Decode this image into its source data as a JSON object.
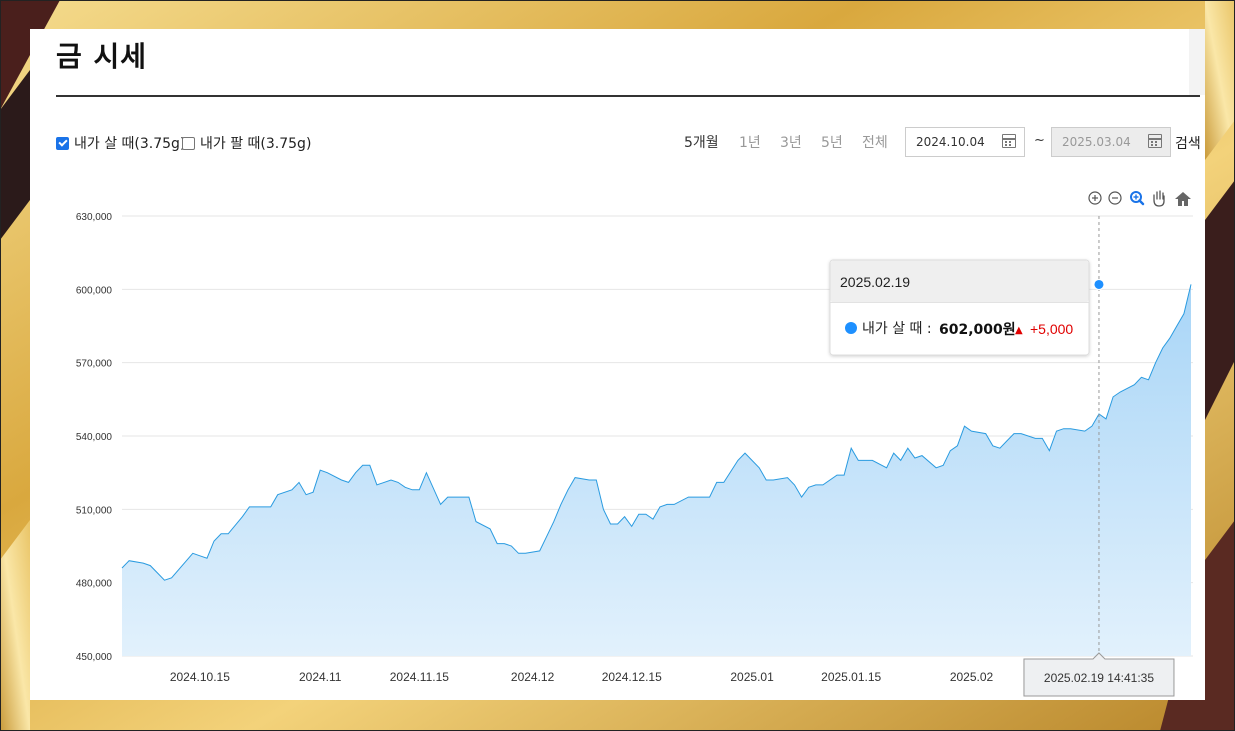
{
  "header": {
    "title": "금 시세"
  },
  "filters": {
    "buy_label": "내가 살 때(3.75g)",
    "sell_label": "내가 팔 때(3.75g)",
    "buy_checked": true,
    "sell_checked": false
  },
  "periods": [
    "5개월",
    "1년",
    "3년",
    "5년",
    "전체"
  ],
  "active_period": "5개월",
  "date_range": {
    "start": "2024.10.04",
    "end": "2025.03.04",
    "separator": "~"
  },
  "search_label": "검색",
  "toolbar_icons": [
    "zoom-in-icon",
    "zoom-out-icon",
    "magnify-icon",
    "pan-hand-icon",
    "home-icon"
  ],
  "colors": {
    "line": "#2a9be0",
    "fill_top": "#a8d5f7",
    "fill_bottom": "#e2f1fc",
    "accent": "#1a73e8",
    "up": "#e00000"
  },
  "tooltip": {
    "date": "2025.02.19",
    "series_label": "내가 살 때 :",
    "value": "602,000원",
    "change_symbol": "▲",
    "change": "+5,000"
  },
  "crosshair_label": "2025.02.19 14:41:35",
  "chart_data": {
    "type": "area",
    "ylim": [
      450000,
      630000
    ],
    "yticks": [
      450000,
      480000,
      510000,
      540000,
      570000,
      600000,
      630000
    ],
    "ytick_labels": [
      "450,000",
      "480,000",
      "510,000",
      "540,000",
      "570,000",
      "600,000",
      "630,000"
    ],
    "xlim": [
      "2024.10.04",
      "2025.03.04"
    ],
    "xticks": [
      "2024.10.15",
      "2024.11",
      "2024.11.15",
      "2024.12",
      "2024.12.15",
      "2025.01",
      "2025.01.15",
      "2025.02"
    ],
    "xtick_dates": [
      "2024-10-15",
      "2024-11-01",
      "2024-11-15",
      "2024-12-01",
      "2024-12-15",
      "2025-01-01",
      "2025-01-15",
      "2025-02-01"
    ],
    "highlight": {
      "date": "2025-02-19",
      "value": 602000
    },
    "series": [
      {
        "name": "내가 살 때",
        "points": [
          [
            "2024-10-04",
            486000
          ],
          [
            "2024-10-05",
            489000
          ],
          [
            "2024-10-07",
            488000
          ],
          [
            "2024-10-08",
            487000
          ],
          [
            "2024-10-09",
            484000
          ],
          [
            "2024-10-10",
            481000
          ],
          [
            "2024-10-11",
            482000
          ],
          [
            "2024-10-14",
            492000
          ],
          [
            "2024-10-15",
            491000
          ],
          [
            "2024-10-16",
            490000
          ],
          [
            "2024-10-17",
            497000
          ],
          [
            "2024-10-18",
            500000
          ],
          [
            "2024-10-19",
            500000
          ],
          [
            "2024-10-21",
            507000
          ],
          [
            "2024-10-22",
            511000
          ],
          [
            "2024-10-23",
            511000
          ],
          [
            "2024-10-24",
            511000
          ],
          [
            "2024-10-25",
            511000
          ],
          [
            "2024-10-26",
            516000
          ],
          [
            "2024-10-28",
            518000
          ],
          [
            "2024-10-29",
            521000
          ],
          [
            "2024-10-30",
            516000
          ],
          [
            "2024-10-31",
            517000
          ],
          [
            "2024-11-01",
            526000
          ],
          [
            "2024-11-02",
            525000
          ],
          [
            "2024-11-04",
            522000
          ],
          [
            "2024-11-05",
            521000
          ],
          [
            "2024-11-06",
            525000
          ],
          [
            "2024-11-07",
            528000
          ],
          [
            "2024-11-08",
            528000
          ],
          [
            "2024-11-09",
            520000
          ],
          [
            "2024-11-11",
            522000
          ],
          [
            "2024-11-12",
            521000
          ],
          [
            "2024-11-13",
            519000
          ],
          [
            "2024-11-14",
            518000
          ],
          [
            "2024-11-15",
            518000
          ],
          [
            "2024-11-16",
            525000
          ],
          [
            "2024-11-18",
            512000
          ],
          [
            "2024-11-19",
            515000
          ],
          [
            "2024-11-20",
            515000
          ],
          [
            "2024-11-21",
            515000
          ],
          [
            "2024-11-22",
            515000
          ],
          [
            "2024-11-23",
            505000
          ],
          [
            "2024-11-25",
            502000
          ],
          [
            "2024-11-26",
            496000
          ],
          [
            "2024-11-27",
            496000
          ],
          [
            "2024-11-28",
            495000
          ],
          [
            "2024-11-29",
            492000
          ],
          [
            "2024-11-30",
            492000
          ],
          [
            "2024-12-02",
            493000
          ],
          [
            "2024-12-03",
            499000
          ],
          [
            "2024-12-04",
            505000
          ],
          [
            "2024-12-05",
            512000
          ],
          [
            "2024-12-06",
            518000
          ],
          [
            "2024-12-07",
            523000
          ],
          [
            "2024-12-09",
            522000
          ],
          [
            "2024-12-10",
            522000
          ],
          [
            "2024-12-11",
            510000
          ],
          [
            "2024-12-12",
            504000
          ],
          [
            "2024-12-13",
            504000
          ],
          [
            "2024-12-14",
            507000
          ],
          [
            "2024-12-15",
            503000
          ],
          [
            "2024-12-16",
            508000
          ],
          [
            "2024-12-17",
            508000
          ],
          [
            "2024-12-18",
            506000
          ],
          [
            "2024-12-19",
            511000
          ],
          [
            "2024-12-20",
            512000
          ],
          [
            "2024-12-21",
            512000
          ],
          [
            "2024-12-23",
            515000
          ],
          [
            "2024-12-24",
            515000
          ],
          [
            "2024-12-26",
            515000
          ],
          [
            "2024-12-27",
            521000
          ],
          [
            "2024-12-28",
            521000
          ],
          [
            "2024-12-30",
            530000
          ],
          [
            "2024-12-31",
            533000
          ],
          [
            "2025-01-02",
            527000
          ],
          [
            "2025-01-03",
            522000
          ],
          [
            "2025-01-04",
            522000
          ],
          [
            "2025-01-06",
            523000
          ],
          [
            "2025-01-07",
            520000
          ],
          [
            "2025-01-08",
            515000
          ],
          [
            "2025-01-09",
            519000
          ],
          [
            "2025-01-10",
            520000
          ],
          [
            "2025-01-11",
            520000
          ],
          [
            "2025-01-13",
            524000
          ],
          [
            "2025-01-14",
            524000
          ],
          [
            "2025-01-15",
            535000
          ],
          [
            "2025-01-16",
            530000
          ],
          [
            "2025-01-17",
            530000
          ],
          [
            "2025-01-18",
            530000
          ],
          [
            "2025-01-20",
            527000
          ],
          [
            "2025-01-21",
            533000
          ],
          [
            "2025-01-22",
            530000
          ],
          [
            "2025-01-23",
            535000
          ],
          [
            "2025-01-24",
            531000
          ],
          [
            "2025-01-25",
            532000
          ],
          [
            "2025-01-27",
            527000
          ],
          [
            "2025-01-28",
            528000
          ],
          [
            "2025-01-29",
            534000
          ],
          [
            "2025-01-30",
            536000
          ],
          [
            "2025-01-31",
            544000
          ],
          [
            "2025-02-01",
            542000
          ],
          [
            "2025-02-03",
            541000
          ],
          [
            "2025-02-04",
            536000
          ],
          [
            "2025-02-05",
            535000
          ],
          [
            "2025-02-06",
            538000
          ],
          [
            "2025-02-07",
            541000
          ],
          [
            "2025-02-08",
            541000
          ],
          [
            "2025-02-10",
            539000
          ],
          [
            "2025-02-11",
            539000
          ],
          [
            "2025-02-12",
            534000
          ],
          [
            "2025-02-13",
            542000
          ],
          [
            "2025-02-14",
            543000
          ],
          [
            "2025-02-15",
            543000
          ],
          [
            "2025-02-17",
            542000
          ],
          [
            "2025-02-18",
            544000
          ],
          [
            "2025-02-19",
            549000
          ],
          [
            "2025-02-20",
            547000
          ],
          [
            "2025-02-21",
            556000
          ],
          [
            "2025-02-22",
            558000
          ],
          [
            "2025-02-24",
            561000
          ],
          [
            "2025-02-25",
            564000
          ],
          [
            "2025-02-26",
            563000
          ],
          [
            "2025-02-27",
            570000
          ],
          [
            "2025-02-28",
            576000
          ],
          [
            "2025-03-01",
            580000
          ],
          [
            "2025-03-02",
            585000
          ],
          [
            "2025-03-03",
            590000
          ],
          [
            "2025-03-04",
            602000
          ]
        ]
      }
    ]
  }
}
